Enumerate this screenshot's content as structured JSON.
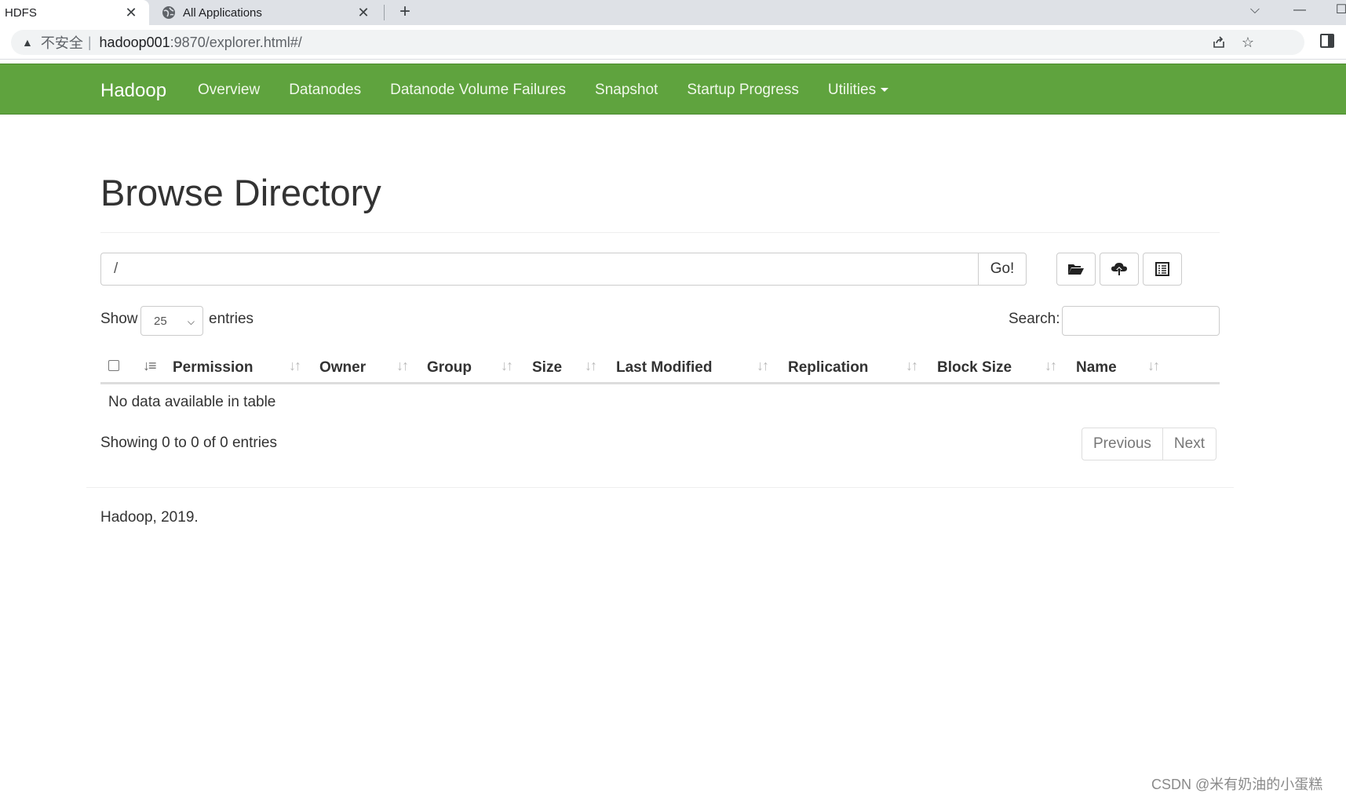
{
  "browser": {
    "tabs": [
      {
        "title": "HDFS",
        "close": "✕"
      },
      {
        "title": "All Applications",
        "close": "✕"
      }
    ],
    "new_tab": "+",
    "window_controls": {
      "dropdown": "⌵",
      "minimize": "—",
      "maximize": "☐"
    },
    "address": {
      "warning_icon": "▲",
      "security_label": "不安全",
      "divider": "|",
      "host": "hadoop001",
      "path": ":9870/explorer.html#/"
    },
    "icons": [
      "share-icon",
      "bookmark-star-icon",
      "side-panel-icon"
    ]
  },
  "navbar": {
    "brand": "Hadoop",
    "items": [
      "Overview",
      "Datanodes",
      "Datanode Volume Failures",
      "Snapshot",
      "Startup Progress",
      "Utilities"
    ],
    "background": "#5fa33e"
  },
  "main": {
    "title": "Browse Directory",
    "path_value": "/",
    "go_label": "Go!",
    "toolbar_icons": [
      "folder-open-icon",
      "cloud-upload-icon",
      "list-icon"
    ],
    "show_label": "Show",
    "entries_value": "25",
    "entries_label": "entries",
    "search_label": "Search:",
    "columns": [
      "Permission",
      "Owner",
      "Group",
      "Size",
      "Last Modified",
      "Replication",
      "Block Size",
      "Name"
    ],
    "empty_message": "No data available in table",
    "info": "Showing 0 to 0 of 0 entries",
    "pager": {
      "previous": "Previous",
      "next": "Next"
    }
  },
  "footer": {
    "text": "Hadoop, 2019."
  },
  "watermark": "CSDN @米有奶油的小蛋糕"
}
